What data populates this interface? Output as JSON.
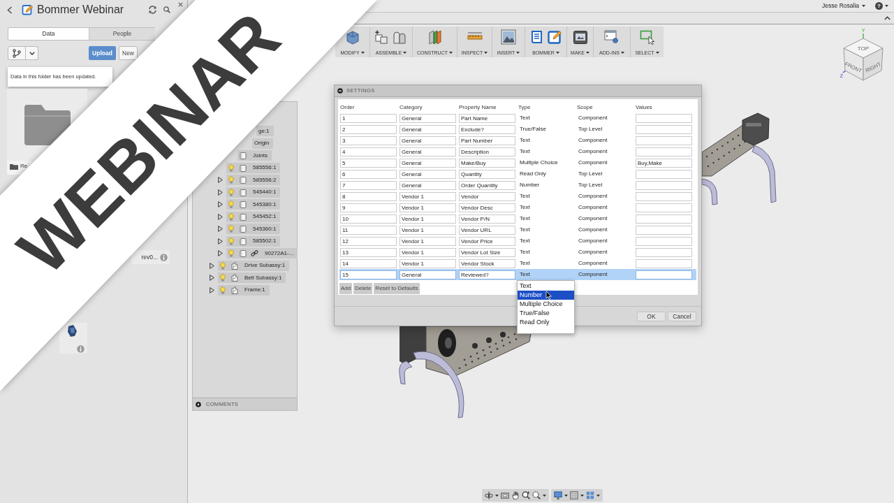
{
  "banner": {
    "text": "WEBINAR"
  },
  "data_panel": {
    "title": "Bommer Webinar",
    "tabs": [
      {
        "label": "Data",
        "selected": true
      },
      {
        "label": "People",
        "selected": false
      }
    ],
    "upload_button": "Upload",
    "new_button": "New",
    "notice": "Data in this folder has been updated.",
    "items": [
      {
        "kind": "folder",
        "label": "Re"
      },
      {
        "kind": "design",
        "label": "rev0...",
        "thumbnail": false
      },
      {
        "kind": "design",
        "thumbnail": true
      }
    ]
  },
  "top_bar": {
    "user": "Jesse Rosalia",
    "help": "?"
  },
  "toolbar": {
    "groups": [
      {
        "label": "MODIFY"
      },
      {
        "label": "ASSEMBLE"
      },
      {
        "label": "CONSTRUCT"
      },
      {
        "label": "INSPECT"
      },
      {
        "label": "INSERT"
      },
      {
        "label": "BOMMER"
      },
      {
        "label": "MAKE"
      },
      {
        "label": "ADD-INS"
      },
      {
        "label": "SELECT"
      }
    ]
  },
  "browser": {
    "nodes": [
      {
        "label": "ge:1",
        "children": [
          {
            "label": "Origin",
            "kind": "origin",
            "linked": false
          },
          {
            "label": "Joints",
            "kind": "folder",
            "linked": false
          },
          {
            "label": "585556:1",
            "kind": "component",
            "visible": true,
            "linked": false
          },
          {
            "label": "585556:2",
            "kind": "component",
            "expanded": false,
            "visible": true,
            "linked": false
          },
          {
            "label": "545440:1",
            "kind": "component",
            "expanded": false,
            "visible": true,
            "linked": false
          },
          {
            "label": "545380:1",
            "kind": "component",
            "expanded": false,
            "visible": true,
            "linked": false
          },
          {
            "label": "545452:1",
            "kind": "component",
            "expanded": false,
            "visible": true,
            "linked": false
          },
          {
            "label": "545360:1",
            "kind": "component",
            "expanded": false,
            "visible": true,
            "linked": false
          },
          {
            "label": "585502:1",
            "kind": "component",
            "expanded": false,
            "visible": true,
            "linked": false
          },
          {
            "label": "90272A1-...",
            "kind": "component",
            "expanded": false,
            "visible": true,
            "linked": true
          }
        ]
      },
      {
        "label": "Drive Subassy:1",
        "kind": "assembly",
        "expanded": false,
        "visible": true,
        "linked": false
      },
      {
        "label": "Belt Subassy:1",
        "kind": "assembly",
        "expanded": false,
        "visible": true,
        "linked": false
      },
      {
        "label": "Frame:1",
        "kind": "assembly",
        "expanded": false,
        "visible": true,
        "linked": false
      }
    ],
    "comments": "COMMENTS"
  },
  "settings_dialog": {
    "title": "SETTINGS",
    "columns": [
      "Order",
      "Category",
      "Property Name",
      "Type",
      "Scope",
      "Values"
    ],
    "rows": [
      {
        "order": "1",
        "category": "General",
        "property_name": "Part Name",
        "type": "Text",
        "scope": "Component",
        "selected": false
      },
      {
        "order": "2",
        "category": "General",
        "property_name": "Exclude?",
        "type": "True/False",
        "scope": "Top Level",
        "selected": false
      },
      {
        "order": "3",
        "category": "General",
        "property_name": "Part Number",
        "type": "Text",
        "scope": "Component",
        "selected": false
      },
      {
        "order": "4",
        "category": "General",
        "property_name": "Description",
        "type": "Text",
        "scope": "Component",
        "selected": false
      },
      {
        "order": "5",
        "category": "General",
        "property_name": "Make/Buy",
        "type": "Multiple Choice",
        "scope": "Component",
        "values": "Buy,Make",
        "selected": false
      },
      {
        "order": "6",
        "category": "General",
        "property_name": "Quantity",
        "type": "Read Only",
        "scope": "Top Level",
        "selected": false
      },
      {
        "order": "7",
        "category": "General",
        "property_name": "Order Quantity",
        "type": "Number",
        "scope": "Top Level",
        "selected": false
      },
      {
        "order": "8",
        "category": "Vendor 1",
        "property_name": "Vendor",
        "type": "Text",
        "scope": "Component",
        "selected": false
      },
      {
        "order": "9",
        "category": "Vendor 1",
        "property_name": "Vendor Desc",
        "type": "Text",
        "scope": "Component",
        "selected": false
      },
      {
        "order": "10",
        "category": "Vendor 1",
        "property_name": "Vendor P/N",
        "type": "Text",
        "scope": "Component",
        "selected": false
      },
      {
        "order": "11",
        "category": "Vendor 1",
        "property_name": "Vendor URL",
        "type": "Text",
        "scope": "Component",
        "selected": false
      },
      {
        "order": "12",
        "category": "Vendor 1",
        "property_name": "Vendor Price",
        "type": "Text",
        "scope": "Component",
        "selected": false
      },
      {
        "order": "13",
        "category": "Vendor 1",
        "property_name": "Vendor Lot Size",
        "type": "Text",
        "scope": "Component",
        "selected": false
      },
      {
        "order": "14",
        "category": "Vendor 1",
        "property_name": "Vendor Stock",
        "type": "Text",
        "scope": "Component",
        "selected": false
      },
      {
        "order": "15",
        "category": "General",
        "property_name": "Reviewed?",
        "type": "Text",
        "scope": "Component",
        "selected": true
      }
    ],
    "type_menu": {
      "options": [
        {
          "label": "Text",
          "selected": false
        },
        {
          "label": "Number",
          "selected": true
        },
        {
          "label": "Multiple Choice",
          "selected": false
        },
        {
          "label": "True/False",
          "selected": false
        },
        {
          "label": "Read Only",
          "selected": false
        }
      ]
    },
    "buttons": [
      "Add",
      "Delete",
      "Reset to Defaults"
    ],
    "footer_buttons": [
      "OK",
      "Cancel"
    ]
  },
  "view_cube": {
    "faces": [
      "TOP",
      "FRONT",
      "RIGHT"
    ],
    "axes": [
      "Y",
      "Z"
    ]
  }
}
